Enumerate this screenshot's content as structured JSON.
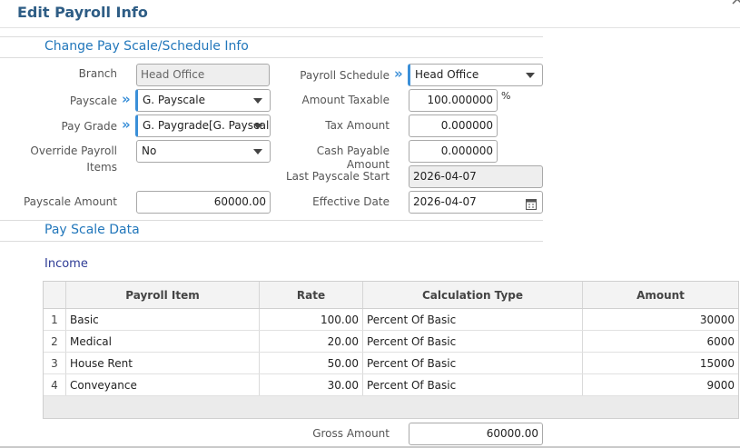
{
  "dialog": {
    "title": "Edit Payroll Info"
  },
  "change_section": {
    "title": "Change Pay Scale/Schedule Info"
  },
  "fields": {
    "branch": {
      "label": "Branch",
      "value": "Head Office"
    },
    "payroll_schedule": {
      "label": "Payroll Schedule",
      "value": "Head Office"
    },
    "payscale": {
      "label": "Payscale",
      "value": "G. Payscale"
    },
    "amount_taxable": {
      "label": "Amount Taxable",
      "value": "100.000000",
      "unit": "%"
    },
    "pay_grade": {
      "label": "Pay Grade",
      "value": "G. Paygrade[G. Payscale]"
    },
    "tax_amount": {
      "label": "Tax Amount",
      "value": "0.000000"
    },
    "override_payroll_items": {
      "label_line1": "Override Payroll",
      "label_line2": "Items",
      "value": "No"
    },
    "cash_payable_amount": {
      "label": "Cash Payable Amount",
      "value": "0.000000"
    },
    "last_payscale_start": {
      "label": "Last Payscale Start",
      "value": "2026-04-07"
    },
    "payscale_amount": {
      "label": "Payscale Amount",
      "value": "60000.00"
    },
    "effective_date": {
      "label": "Effective Date",
      "value": "2026-04-07"
    }
  },
  "payscale_section": {
    "title": "Pay Scale Data"
  },
  "income": {
    "title": "Income",
    "columns": [
      "",
      "Payroll Item",
      "Rate",
      "Calculation Type",
      "Amount"
    ],
    "rows": [
      {
        "index": "1",
        "item": "Basic",
        "rate": "100.00",
        "calc": "Percent Of Basic",
        "amount": "30000"
      },
      {
        "index": "2",
        "item": "Medical",
        "rate": "20.00",
        "calc": "Percent Of Basic",
        "amount": "6000"
      },
      {
        "index": "3",
        "item": "House Rent",
        "rate": "50.00",
        "calc": "Percent Of Basic",
        "amount": "15000"
      },
      {
        "index": "4",
        "item": "Conveyance",
        "rate": "30.00",
        "calc": "Percent Of Basic",
        "amount": "9000"
      }
    ]
  },
  "gross": {
    "label": "Gross Amount",
    "value": "60000.00"
  },
  "icons": {
    "required": "double-chevron-right-icon",
    "dropdown": "caret-down-icon",
    "calendar": "calendar-icon",
    "close": "close-icon"
  },
  "colors": {
    "title": "#2e5d85",
    "section": "#2277bb",
    "required_accent": "#3a8fd8"
  }
}
